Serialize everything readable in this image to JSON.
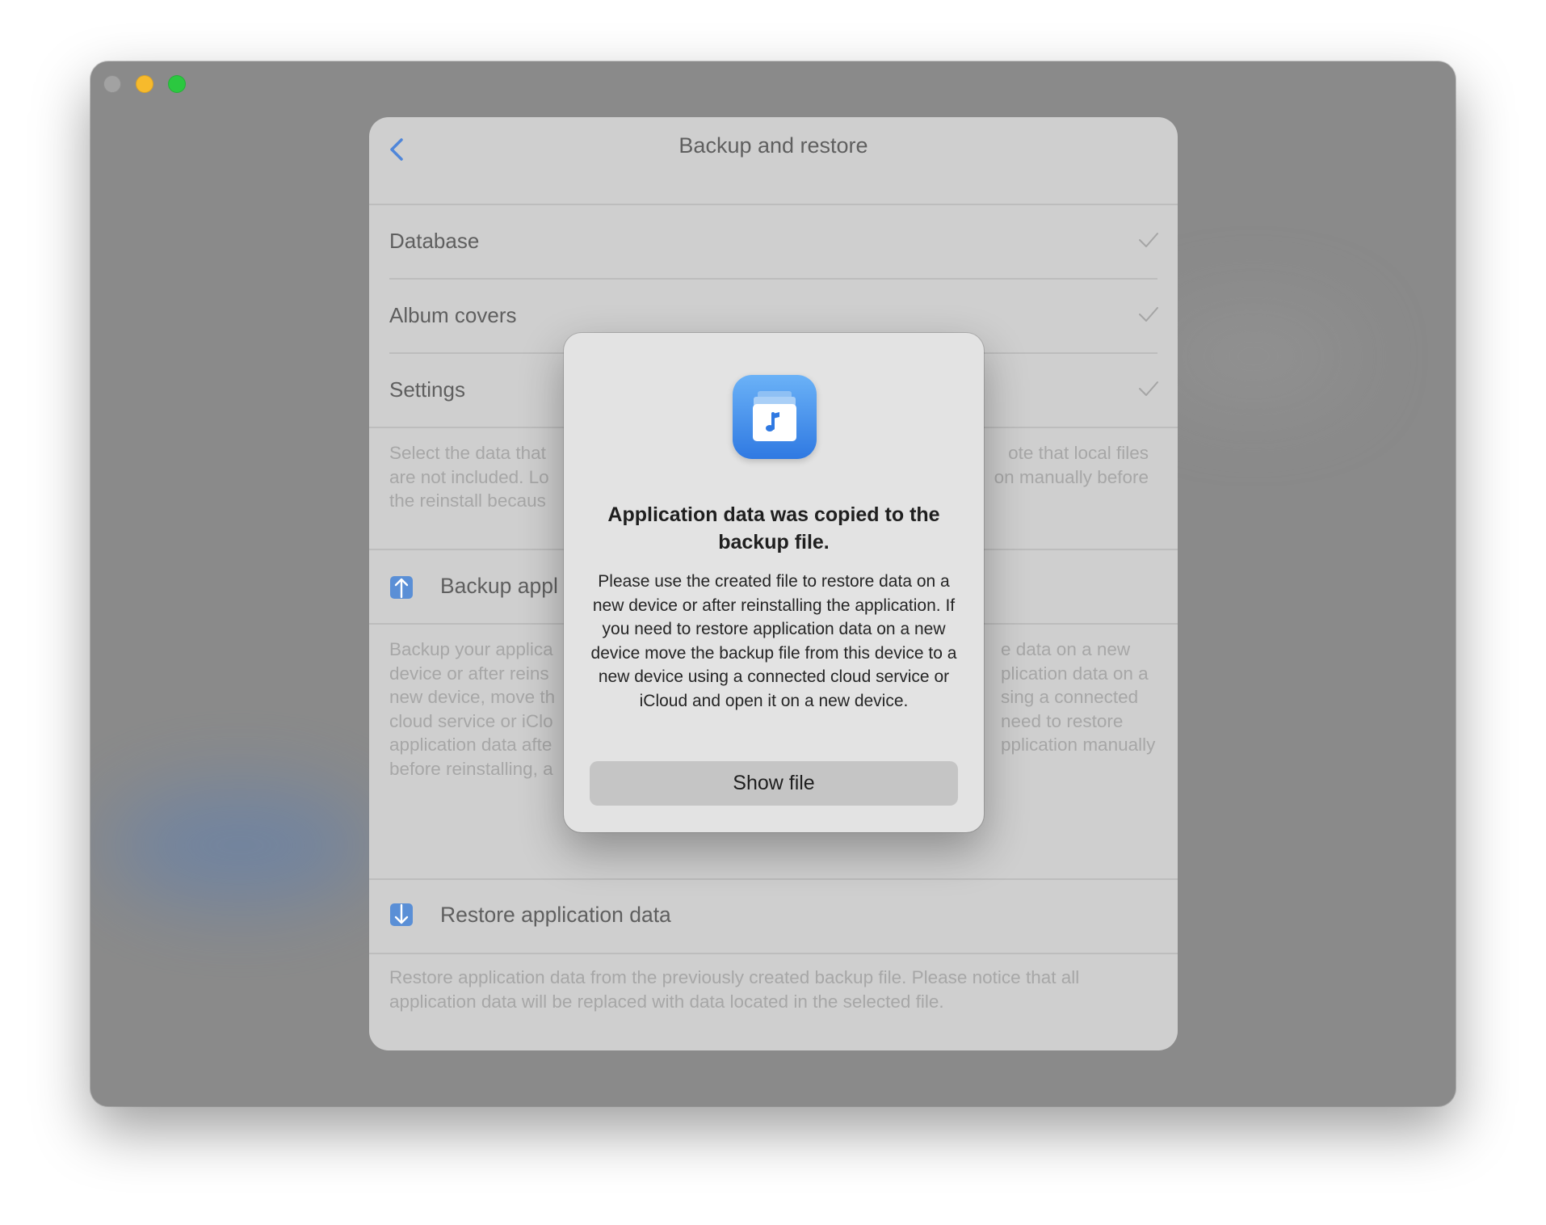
{
  "window": {
    "controls": [
      "close",
      "minimize",
      "zoom"
    ]
  },
  "header": {
    "title": "Backup and restore",
    "back_icon": "chevron-left-icon"
  },
  "data_options": [
    {
      "label": "Database",
      "checked": true
    },
    {
      "label": "Album covers",
      "checked": true
    },
    {
      "label": "Settings",
      "checked": true
    }
  ],
  "selection_note": {
    "left_lines": [
      "Select the data that",
      "are not included. Lo",
      "the reinstall becaus"
    ],
    "right_lines": [
      "ote that local files",
      "on manually before"
    ]
  },
  "backup_section": {
    "title": "Backup appl",
    "icon": "upload-arrow-icon",
    "left_lines": [
      "Backup your applica",
      "device or after reins",
      "new device, move th",
      "cloud service or iClo",
      "application data afte",
      "before reinstalling, a"
    ],
    "right_lines": [
      "e data on a new",
      "plication data on a",
      "sing a connected",
      "need to restore",
      "pplication manually"
    ]
  },
  "restore_section": {
    "title": "Restore application data",
    "icon": "download-arrow-icon",
    "description": "Restore application data from the previously created backup file. Please notice that all application data will be replaced with data located in the selected file."
  },
  "dialog": {
    "icon": "music-file-app-icon",
    "title": "Application data was copied to the backup file.",
    "message": "Please use the created file to restore data on a new device or after reinstalling the application. If you need to restore application data on a new device move the backup file from this device to a new device using a connected cloud service or iCloud and open it on a new device.",
    "button_label": "Show file"
  },
  "colors": {
    "accent": "#2f79e2",
    "window_dimmed": "#8a8a8a",
    "sheet": "#cfcfcf",
    "dialog": "#e3e3e3"
  }
}
